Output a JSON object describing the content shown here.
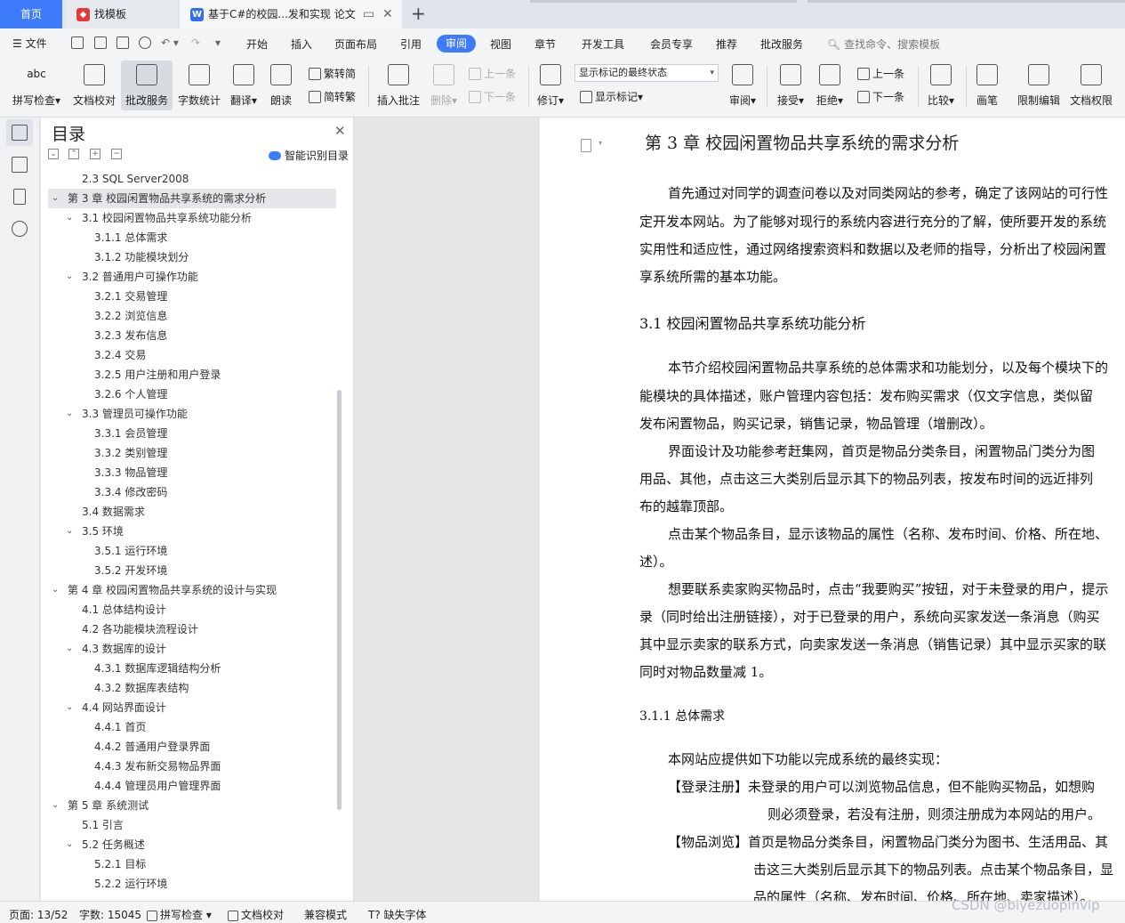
{
  "tabs": {
    "home": "首页",
    "tab1": "找模板",
    "tab2": "基于C#的校园...发和实现 论文",
    "add": "+"
  },
  "menu": {
    "file": "文件",
    "items": [
      "开始",
      "插入",
      "页面布局",
      "引用",
      "审阅",
      "视图",
      "章节",
      "开发工具",
      "会员专享",
      "推荐",
      "批改服务"
    ],
    "active": "审阅",
    "search": "查找命令、搜索模板"
  },
  "ribbon": {
    "spell": "拼写检查",
    "proof": "文档校对",
    "correct": "批改服务",
    "wordcount": "字数统计",
    "translate": "翻译",
    "read": "朗读",
    "trad": "繁转简",
    "simp": "简转繁",
    "insert_comment": "插入批注",
    "delete": "删除",
    "prev": "上一条",
    "next": "下一条",
    "revise": "修订",
    "markup_state": "显示标记的最终状态",
    "show_markup": "显示标记",
    "review": "审阅",
    "accept": "接受",
    "reject": "拒绝",
    "prev2": "上一条",
    "next2": "下一条",
    "compare": "比较",
    "pen": "画笔",
    "restrict": "限制编辑",
    "permission": "文档权限"
  },
  "toc": {
    "title": "目录",
    "smart": "智能识别目录",
    "items": [
      {
        "label": "2.3 SQL Server2008",
        "level": 2,
        "chev": false
      },
      {
        "label": "第 3 章  校园闲置物品共享系统的需求分析",
        "level": 1,
        "chev": true
      },
      {
        "label": "3.1 校园闲置物品共享系统功能分析",
        "level": 2,
        "chev": true
      },
      {
        "label": "3.1.1 总体需求",
        "level": 3,
        "chev": false
      },
      {
        "label": "3.1.2 功能模块划分",
        "level": 3,
        "chev": false
      },
      {
        "label": "3.2 普通用户可操作功能",
        "level": 2,
        "chev": true
      },
      {
        "label": "3.2.1 交易管理",
        "level": 3,
        "chev": false
      },
      {
        "label": "3.2.2 浏览信息",
        "level": 3,
        "chev": false
      },
      {
        "label": "3.2.3 发布信息",
        "level": 3,
        "chev": false
      },
      {
        "label": "3.2.4  交易",
        "level": 3,
        "chev": false
      },
      {
        "label": "3.2.5 用户注册和用户登录",
        "level": 3,
        "chev": false
      },
      {
        "label": "3.2.6 个人管理",
        "level": 3,
        "chev": false
      },
      {
        "label": "3.3 管理员可操作功能",
        "level": 2,
        "chev": true
      },
      {
        "label": "3.3.1 会员管理",
        "level": 3,
        "chev": false
      },
      {
        "label": "3.3.2 类别管理",
        "level": 3,
        "chev": false
      },
      {
        "label": "3.3.3 物品管理",
        "level": 3,
        "chev": false
      },
      {
        "label": "3.3.4  修改密码",
        "level": 3,
        "chev": false
      },
      {
        "label": "3.4 数据需求",
        "level": 2,
        "chev": false
      },
      {
        "label": "3.5 环境",
        "level": 2,
        "chev": true
      },
      {
        "label": "3.5.1 运行环境",
        "level": 3,
        "chev": false
      },
      {
        "label": "3.5.2 开发环境",
        "level": 3,
        "chev": false
      },
      {
        "label": "第 4 章  校园闲置物品共享系统的设计与实现",
        "level": 1,
        "chev": true
      },
      {
        "label": "4.1 总体结构设计",
        "level": 2,
        "chev": false
      },
      {
        "label": "4.2 各功能模块流程设计",
        "level": 2,
        "chev": false
      },
      {
        "label": "4.3 数据库的设计",
        "level": 2,
        "chev": true
      },
      {
        "label": "4.3.1 数据库逻辑结构分析",
        "level": 3,
        "chev": false
      },
      {
        "label": "4.3.2 数据库表结构",
        "level": 3,
        "chev": false
      },
      {
        "label": "4.4 网站界面设计",
        "level": 2,
        "chev": true
      },
      {
        "label": "4.4.1 首页",
        "level": 3,
        "chev": false
      },
      {
        "label": "4.4.2 普通用户登录界面",
        "level": 3,
        "chev": false
      },
      {
        "label": "4.4.3 发布新交易物品界面",
        "level": 3,
        "chev": false
      },
      {
        "label": "4.4.4 管理员用户管理界面",
        "level": 3,
        "chev": false
      },
      {
        "label": "第 5 章  系统测试",
        "level": 1,
        "chev": true
      },
      {
        "label": "5.1  引言",
        "level": 2,
        "chev": false
      },
      {
        "label": "5.2  任务概述",
        "level": 2,
        "chev": true
      },
      {
        "label": "5.2.1  目标",
        "level": 3,
        "chev": false
      },
      {
        "label": "5.2.2  运行环境",
        "level": 3,
        "chev": false
      }
    ]
  },
  "doc": {
    "title": "第 3 章  校园闲置物品共享系统的需求分析",
    "lines": [
      "首先通过对同学的调查问卷以及对同类网站的参考，确定了该网站的可行性",
      "定开发本网站。为了能够对现行的系统内容进行充分的了解，使所要开发的系统",
      "实用性和适应性，通过网络搜索资料和数据以及老师的指导，分析出了校园闲置",
      "享系统所需的基本功能。",
      "3.1 校园闲置物品共享系统功能分析",
      "本节介绍校园闲置物品共享系统的总体需求和功能划分，以及每个模块下的",
      "能模块的具体描述，账户管理内容包括：发布购买需求（仅文字信息，类似留",
      "发布闲置物品，购买记录，销售记录，物品管理（增删改）。",
      "界面设计及功能参考赶集网，首页是物品分类条目，闲置物品门类分为图",
      "用品、其他，点击这三大类别后显示其下的物品列表，按发布时间的远近排列",
      "布的越靠顶部。",
      "点击某个物品条目，显示该物品的属性（名称、发布时间、价格、所在地、",
      "述）。",
      "想要联系卖家购买物品时，点击“我要购买”按钮，对于未登录的用户，提示",
      "录（同时给出注册链接），对于已登录的用户，系统向买家发送一条消息（购买",
      "其中显示卖家的联系方式，向卖家发送一条消息（销售记录）其中显示买家的联",
      "同时对物品数量减 1。",
      "3.1.1 总体需求",
      "本网站应提供如下功能以完成系统的最终实现：",
      "【登录注册】未登录的用户可以浏览物品信息，但不能购买物品，如想购",
      "则必须登录，若没有注册，则须注册成为本网站的用户。",
      "【物品浏览】首页是物品分类条目，闲置物品门类分为图书、生活用品、其",
      "击这三大类别后显示其下的物品列表。点击某个物品条目，显",
      "品的属性（名称、发布时间、价格、所在地、卖家描述）。"
    ]
  },
  "status": {
    "page": "页面: 13/52",
    "words": "字数: 15045",
    "spell": "拼写检查",
    "proof": "文档校对",
    "compat": "兼容模式",
    "missing_font": "缺失字体"
  },
  "watermark": "CSDN @biyezuopinvip"
}
